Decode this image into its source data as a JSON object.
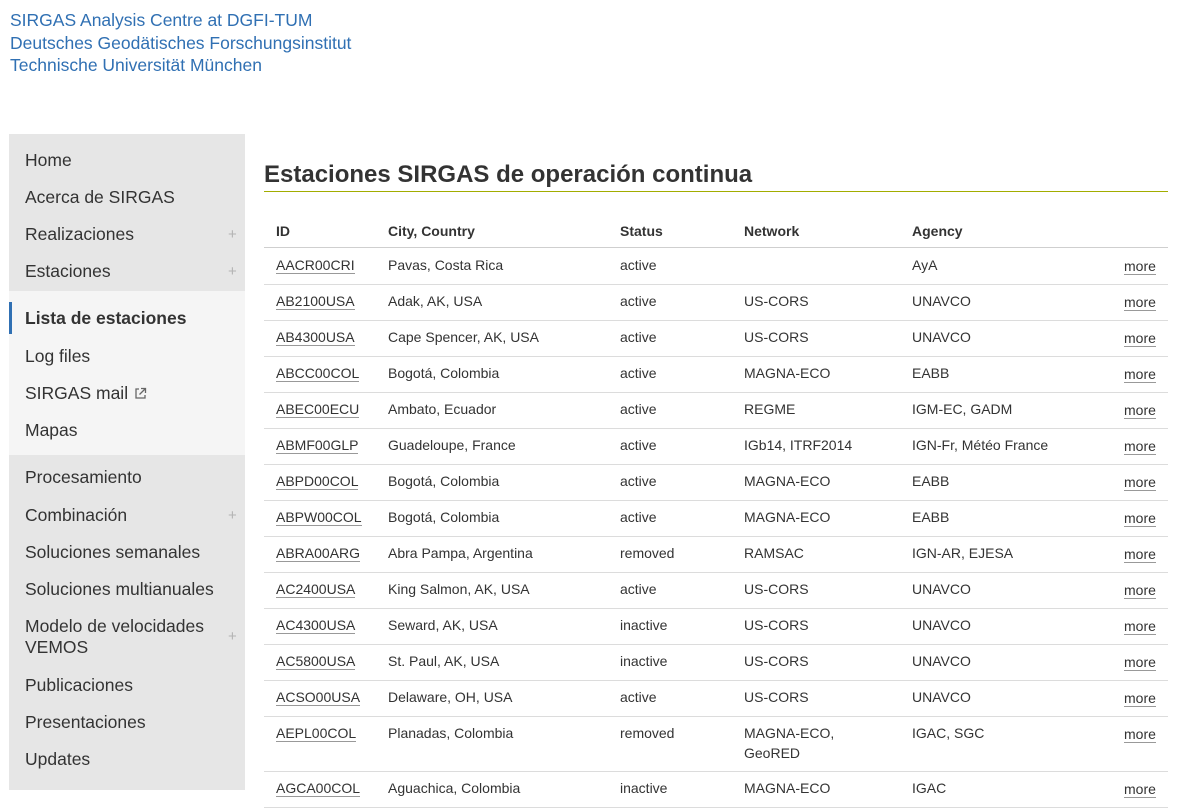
{
  "header": {
    "line1": "SIRGAS Analysis Centre at DGFI-TUM",
    "line2": "Deutsches Geodätisches Forschungsinstitut",
    "line3": "Technische Universität München"
  },
  "sidebar": {
    "items": [
      {
        "label": "Home",
        "expandable": false
      },
      {
        "label": "Acerca de SIRGAS",
        "expandable": false
      },
      {
        "label": "Realizaciones",
        "expandable": true
      },
      {
        "label": "Estaciones",
        "expandable": true
      }
    ],
    "subitems": [
      {
        "label": "Lista de estaciones",
        "active": true
      },
      {
        "label": "Log files"
      },
      {
        "label": "SIRGAS mail",
        "external": true
      },
      {
        "label": "Mapas"
      }
    ],
    "items2": [
      {
        "label": "Procesamiento",
        "expandable": false
      },
      {
        "label": "Combinación",
        "expandable": true
      },
      {
        "label": "Soluciones semanales",
        "expandable": false
      },
      {
        "label": "Soluciones multianuales",
        "expandable": false
      },
      {
        "label": "Modelo de velocidades",
        "label2": "VEMOS",
        "expandable": true
      },
      {
        "label": "Publicaciones",
        "expandable": false
      },
      {
        "label": "Presentaciones",
        "expandable": false
      },
      {
        "label": "Updates",
        "expandable": false
      }
    ],
    "plus_symbol": "+"
  },
  "main": {
    "title": "Estaciones SIRGAS de operación continua",
    "columns": [
      "ID",
      "City, Country",
      "Status",
      "Network",
      "Agency"
    ],
    "more_label": "more",
    "rows": [
      {
        "id": "AACR00CRI",
        "city": "Pavas, Costa Rica",
        "status": "active",
        "network": "",
        "agency": "AyA"
      },
      {
        "id": "AB2100USA",
        "city": "Adak, AK, USA",
        "status": "active",
        "network": "US-CORS",
        "agency": "UNAVCO"
      },
      {
        "id": "AB4300USA",
        "city": "Cape Spencer, AK, USA",
        "status": "active",
        "network": "US-CORS",
        "agency": "UNAVCO"
      },
      {
        "id": "ABCC00COL",
        "city": "Bogotá, Colombia",
        "status": "active",
        "network": "MAGNA-ECO",
        "agency": "EABB"
      },
      {
        "id": "ABEC00ECU",
        "city": "Ambato, Ecuador",
        "status": "active",
        "network": "REGME",
        "agency": "IGM-EC, GADM"
      },
      {
        "id": "ABMF00GLP",
        "city": "Guadeloupe, France",
        "status": "active",
        "network": "IGb14, ITRF2014",
        "agency": "IGN-Fr, Météo France"
      },
      {
        "id": "ABPD00COL",
        "city": "Bogotá, Colombia",
        "status": "active",
        "network": "MAGNA-ECO",
        "agency": "EABB"
      },
      {
        "id": "ABPW00COL",
        "city": "Bogotá, Colombia",
        "status": "active",
        "network": "MAGNA-ECO",
        "agency": "EABB"
      },
      {
        "id": "ABRA00ARG",
        "city": "Abra Pampa, Argentina",
        "status": "removed",
        "network": "RAMSAC",
        "agency": "IGN-AR, EJESA"
      },
      {
        "id": "AC2400USA",
        "city": "King Salmon, AK, USA",
        "status": "active",
        "network": "US-CORS",
        "agency": "UNAVCO"
      },
      {
        "id": "AC4300USA",
        "city": "Seward, AK, USA",
        "status": "inactive",
        "network": "US-CORS",
        "agency": "UNAVCO"
      },
      {
        "id": "AC5800USA",
        "city": "St. Paul, AK, USA",
        "status": "inactive",
        "network": "US-CORS",
        "agency": "UNAVCO"
      },
      {
        "id": "ACSO00USA",
        "city": "Delaware, OH, USA",
        "status": "active",
        "network": "US-CORS",
        "agency": "UNAVCO"
      },
      {
        "id": "AEPL00COL",
        "city": "Planadas, Colombia",
        "status": "removed",
        "network": "MAGNA-ECO,",
        "network2": "GeoRED",
        "agency": "IGAC, SGC"
      },
      {
        "id": "AGCA00COL",
        "city": "Aguachica, Colombia",
        "status": "inactive",
        "network": "MAGNA-ECO",
        "agency": "IGAC"
      }
    ]
  },
  "colors": {
    "link_blue": "#3070b3",
    "title_rule": "#a2ad00",
    "sidebar_bg": "#e6e6e6",
    "sidebar_sub_bg": "#f5f5f5"
  }
}
